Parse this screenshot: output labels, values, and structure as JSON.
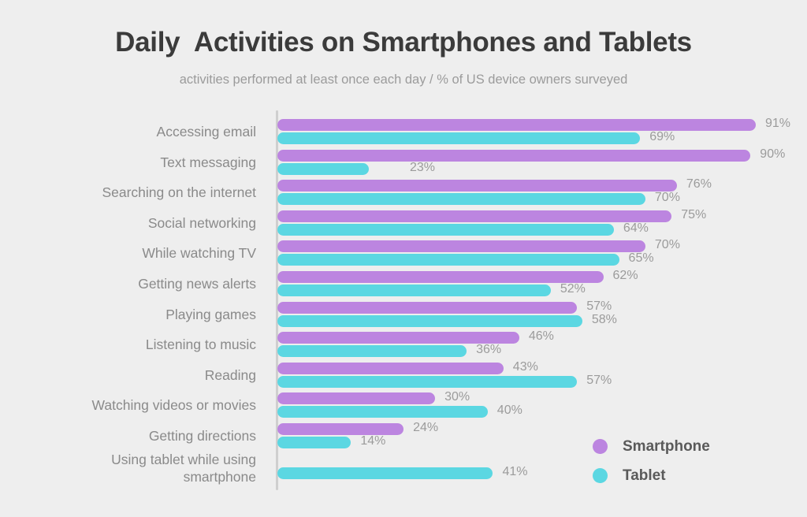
{
  "chart_data": {
    "type": "bar",
    "orientation": "horizontal",
    "title": "Daily  Activities on Smartphones and Tablets",
    "subtitle": "activities performed at least once each day / % of US device owners surveyed",
    "xlabel": "",
    "ylabel": "",
    "xlim": [
      0,
      100
    ],
    "grid": false,
    "value_suffix": "%",
    "legend_position": "bottom-right",
    "categories": [
      "Accessing email",
      "Text  messaging",
      "Searching on the internet",
      "Social networking",
      "While watching TV",
      "Getting news alerts",
      "Playing games",
      "Listening to music",
      "Reading",
      "Watching videos or movies",
      "Getting directions",
      "Using tablet while using\nsmartphone"
    ],
    "series": [
      {
        "name": "Smartphone",
        "color": "#bc85e0",
        "values": [
          91,
          90,
          76,
          75,
          70,
          62,
          57,
          46,
          43,
          30,
          24,
          null
        ],
        "labels": [
          "91%",
          "90%",
          "76%",
          "75%",
          "70%",
          "62%",
          "57%",
          "46%",
          "43%",
          "30%",
          "24%",
          null
        ]
      },
      {
        "name": "Tablet",
        "color": "#5bd7e2",
        "values": [
          69,
          23,
          70,
          64,
          65,
          52,
          58,
          36,
          57,
          40,
          14,
          41
        ],
        "labels": [
          "69%",
          "23%",
          "70%",
          "64%",
          "65%",
          "52%",
          "58%",
          "36%",
          "57%",
          "40%",
          "14%",
          "41%"
        ]
      }
    ]
  },
  "legend": {
    "items": [
      {
        "label": "Smartphone",
        "color": "#bc85e0"
      },
      {
        "label": "Tablet",
        "color": "#5bd7e2"
      }
    ]
  },
  "colors": {
    "background": "#eeeeee",
    "smartphone": "#bc85e0",
    "tablet": "#5bd7e2",
    "title_text": "#3b3b3b",
    "subtitle_text": "#9b9b9b",
    "label_text": "#8a8a8a",
    "value_text": "#9b9b9b",
    "axis_line": "#cfcfcf",
    "legend_text": "#5a5a5a"
  }
}
